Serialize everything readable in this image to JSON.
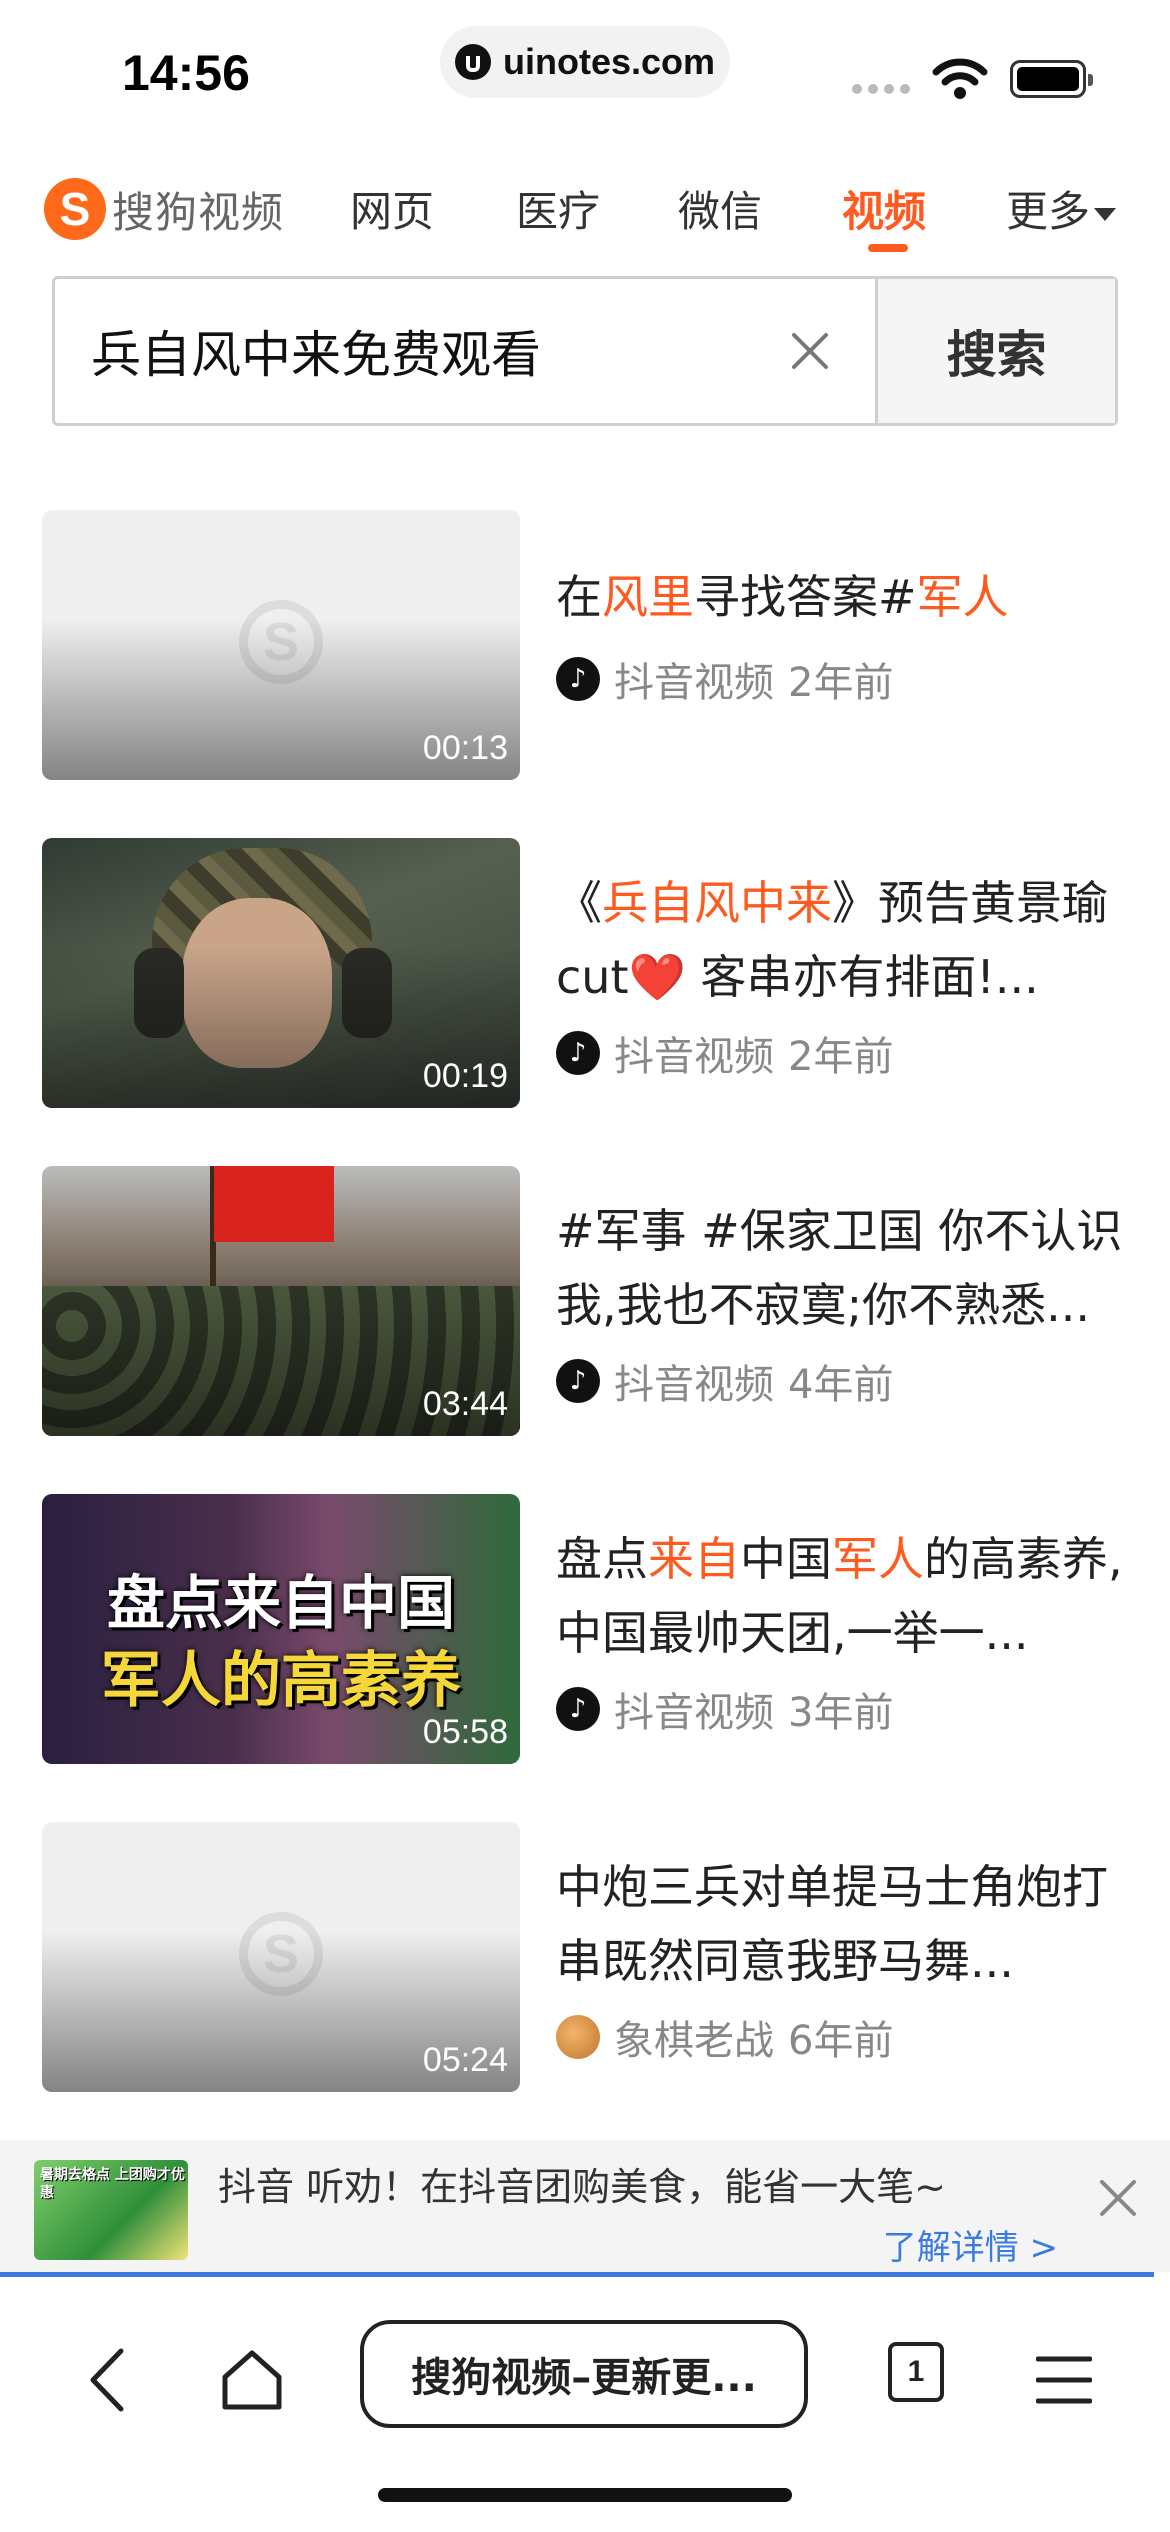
{
  "status_bar": {
    "time": "14:56",
    "url": "uinotes.com"
  },
  "nav": {
    "logo_mark": "S",
    "logo_text": "搜狗视频",
    "items": [
      {
        "label": "网页",
        "active": false
      },
      {
        "label": "医疗",
        "active": false
      },
      {
        "label": "微信",
        "active": false
      },
      {
        "label": "视频",
        "active": true
      },
      {
        "label": "更多",
        "active": false
      }
    ]
  },
  "search": {
    "query": "兵自风中来免费观看",
    "button": "搜索"
  },
  "results": [
    {
      "duration": "00:13",
      "title_parts": [
        {
          "t": "在",
          "hl": false
        },
        {
          "t": "风里",
          "hl": true
        },
        {
          "t": "寻找答案#",
          "hl": false
        },
        {
          "t": "军人",
          "hl": true
        }
      ],
      "source": "抖音视频",
      "age": "2年前",
      "thumb": "placeholder"
    },
    {
      "duration": "00:19",
      "title_parts": [
        {
          "t": "《",
          "hl": false
        },
        {
          "t": "兵自风中来",
          "hl": true
        },
        {
          "t": "》预告黄景瑜cut",
          "hl": false
        },
        {
          "t": "❤️",
          "hl": false
        },
        {
          "t": " 客串亦有排面!...",
          "hl": false
        }
      ],
      "source": "抖音视频",
      "age": "2年前",
      "thumb": "soldier"
    },
    {
      "duration": "03:44",
      "title_parts": [
        {
          "t": "#军事 #保家卫国 你不认识我,我也不寂寞;你不熟悉...",
          "hl": false
        }
      ],
      "source": "抖音视频",
      "age": "4年前",
      "thumb": "squad"
    },
    {
      "duration": "05:58",
      "title_parts": [
        {
          "t": "盘点",
          "hl": false
        },
        {
          "t": "来自",
          "hl": true
        },
        {
          "t": "中国",
          "hl": false
        },
        {
          "t": "军人",
          "hl": true
        },
        {
          "t": "的高素养,中国最帅天团,一举一...",
          "hl": false
        }
      ],
      "source": "抖音视频",
      "age": "3年前",
      "thumb": "promo",
      "thumb_text": [
        "盘点来自中国",
        "军人的高素养"
      ]
    },
    {
      "duration": "05:24",
      "title_parts": [
        {
          "t": "中炮三兵对单提马士角炮打串既然同意我野马舞...",
          "hl": false
        }
      ],
      "source": "象棋老战",
      "age": "6年前",
      "thumb": "placeholder"
    }
  ],
  "ad": {
    "brand": "抖音",
    "text": "听劝！在抖音团购美食，能省一大笔~",
    "link": "了解详情 >",
    "img_text": "暑期去格点 上团购才优惠"
  },
  "toolbar": {
    "tab_title": "搜狗视频–更新更...",
    "tab_count": "1"
  },
  "colors": {
    "accent": "#ff5a1f",
    "link": "#3a7be0"
  }
}
